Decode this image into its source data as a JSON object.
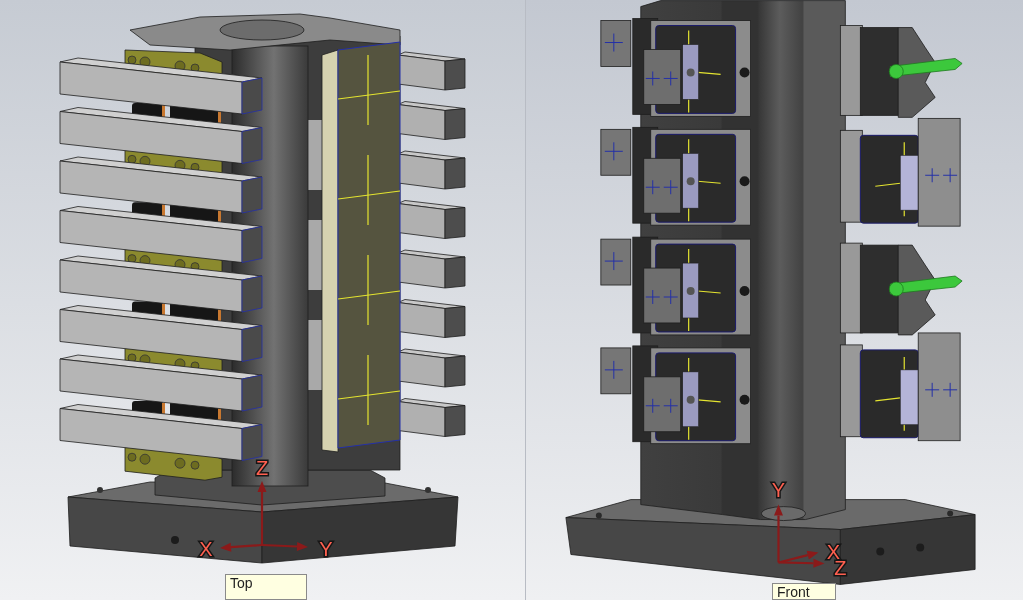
{
  "viewports": [
    {
      "model": {
        "kind": "bar-tower"
      },
      "triad": [
        {
          "label": "X"
        },
        {
          "label": "Y"
        },
        {
          "label": "Z"
        }
      ],
      "view_label": "Top"
    },
    {
      "model": {
        "kind": "vise-tower"
      },
      "triad": [
        {
          "label": "Y"
        },
        {
          "label": "X"
        },
        {
          "label": "Z"
        }
      ],
      "view_label": "Front"
    }
  ]
}
